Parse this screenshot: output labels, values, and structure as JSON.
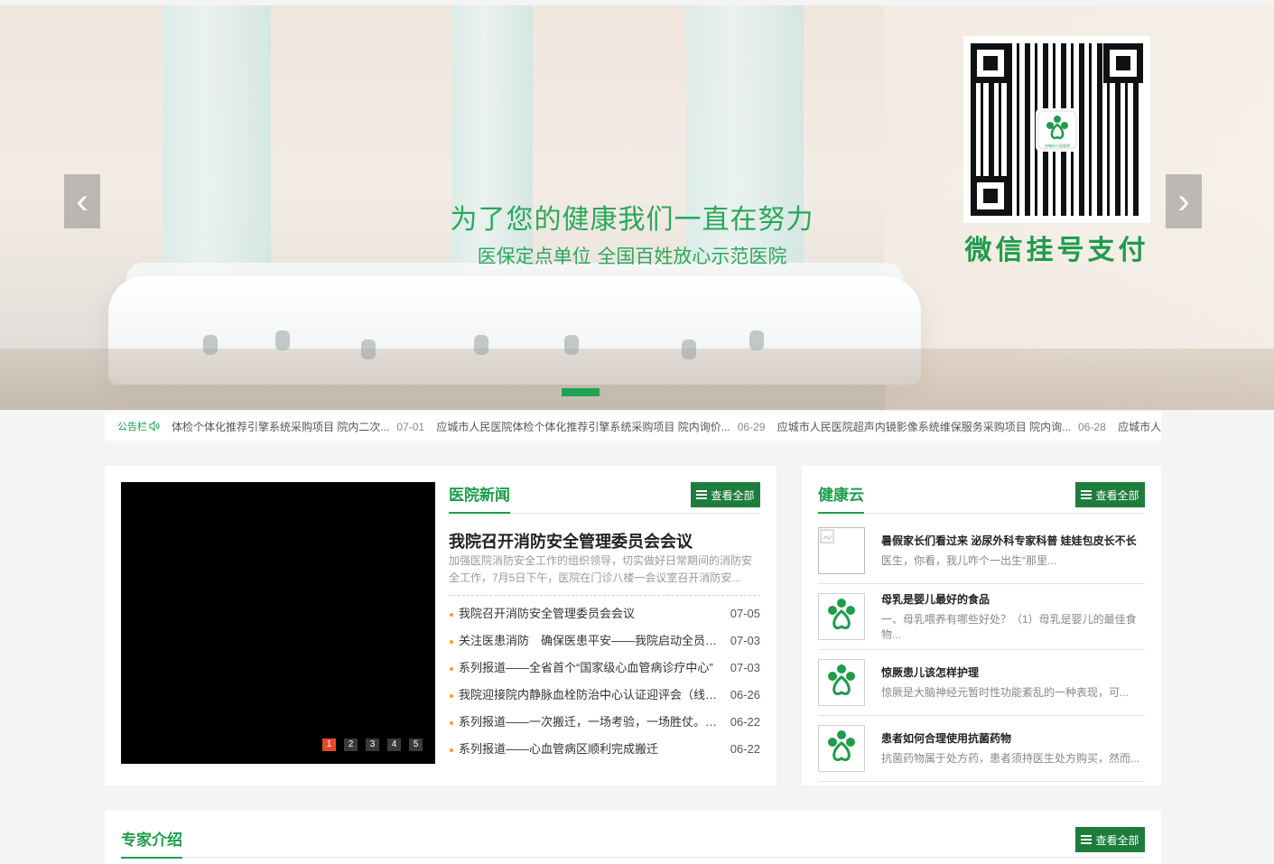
{
  "banner": {
    "slogan_main": "为了您的健康我们一直在努力",
    "slogan_sub": "医保定点单位 全国百姓放心示范医院",
    "qr_logo_text": "应城市人民医院",
    "wx_pay": "微信挂号支付",
    "prev_arrow": "‹",
    "next_arrow": "›"
  },
  "notice": {
    "label": "公告栏",
    "items": [
      {
        "title": "体检个体化推荐引擎系统采购项目 院内二次...",
        "date": "07-01"
      },
      {
        "title": "应城市人民医院体检个体化推荐引擎系统采购项目 院内询价...",
        "date": "06-29"
      },
      {
        "title": "应城市人民医院超声内镜影像系统维保服务采购项目 院内询...",
        "date": "06-28"
      },
      {
        "title": "应城市人民",
        "date": ""
      }
    ]
  },
  "news": {
    "section_title": "医院新闻",
    "more_label": "查看全部",
    "lead_title": "我院召开消防安全管理委员会会议",
    "lead_summary": "加强医院消防安全工作的组织领导，切实做好日常期间的消防安全工作，7月5日下午，医院在门诊八楼一会议室召开消防安...",
    "pager": [
      "1",
      "2",
      "3",
      "4",
      "5"
    ],
    "items": [
      {
        "title": "我院召开消防安全管理委员会会议",
        "date": "07-05"
      },
      {
        "title": "关注医患消防　确保医患平安——我院启动全员消防安全培训",
        "date": "07-03"
      },
      {
        "title": "系列报道——全省首个“国家级心血管病诊疗中心”",
        "date": "07-03"
      },
      {
        "title": "我院迎接院内静脉血栓防治中心认证迎评会（线上）",
        "date": "06-26"
      },
      {
        "title": "系列报道——一次搬迁，一场考验，一场胜仗。——记",
        "date": "06-22"
      },
      {
        "title": "系列报道——心血管病区顺利完成搬迁",
        "date": "06-22"
      }
    ]
  },
  "health": {
    "section_title": "健康云",
    "more_label": "查看全部",
    "items": [
      {
        "title": "暑假家长们看过来 泌尿外科专家科普 娃娃包皮长不长",
        "summary": "医生，你看，我儿咋个一出生“那里...",
        "thumb": "broken-image"
      },
      {
        "title": "母乳是婴儿最好的食品",
        "summary": "一、母乳喂养有哪些好处？（1）母乳是婴儿的最佳食物...",
        "thumb": "hospital-logo"
      },
      {
        "title": "惊厥患儿该怎样护理",
        "summary": "惊厥是大脑神经元暂时性功能紊乱的一种表现，可...",
        "thumb": "hospital-logo"
      },
      {
        "title": "患者如何合理使用抗菌药物",
        "summary": "抗菌药物属于处方药，患者须持医生处方购买，然而...",
        "thumb": "hospital-logo"
      }
    ]
  },
  "experts": {
    "section_title": "专家介绍",
    "more_label": "查看全部"
  },
  "colors": {
    "brand_green": "#1e9c4c",
    "button_green": "#1e7d3d",
    "pager_active": "#e8482a",
    "bullet": "#f0a21e"
  }
}
